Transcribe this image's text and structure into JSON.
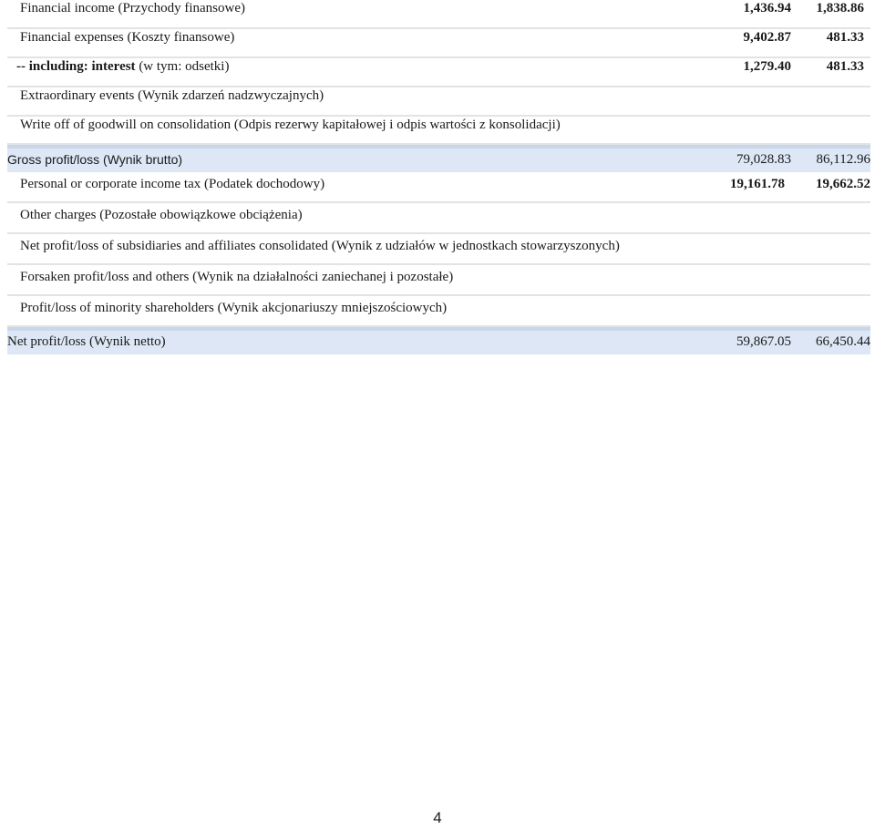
{
  "rows": [
    {
      "label": "Financial income (Przychody finansowe)",
      "v1": "1,436.94",
      "v2": "1,838.86"
    },
    {
      "label": "Financial expenses (Koszty finansowe)",
      "v1": "9,402.87",
      "v2": "481.33"
    },
    {
      "label_bold": "-- including: interest",
      "label_rest": " (w tym: odsetki)",
      "v1": "1,279.40",
      "v2": "481.33"
    },
    {
      "label": "Extraordinary events (Wynik zdarzeń nadzwyczajnych)"
    },
    {
      "label": "Write off of goodwill on consolidation (Odpis rezerwy kapitałowej i odpis wartości z konsolidacji)"
    },
    {
      "label": "Gross profit/loss (Wynik brutto)",
      "v1": "79,028.83",
      "v2": "86,112.96"
    },
    {
      "label": "Personal or corporate income tax (Podatek dochodowy)",
      "v1": "19,161.78",
      "v2": "19,662.52"
    },
    {
      "label": "Other charges (Pozostałe obowiązkowe obciążenia)"
    },
    {
      "label": "Net profit/loss of subsidiaries and affiliates consolidated (Wynik z udziałów w jednostkach stowarzyszonych)"
    },
    {
      "label": "Forsaken profit/loss and others (Wynik na działalności zaniechanej i pozostałe)"
    },
    {
      "label": "Profit/loss of minority shareholders (Wynik akcjonariuszy mniejszościowych)"
    },
    {
      "label": "Net profit/loss (Wynik netto)",
      "v1": "59,867.05",
      "v2": "66,450.44"
    }
  ],
  "page_number": "4"
}
